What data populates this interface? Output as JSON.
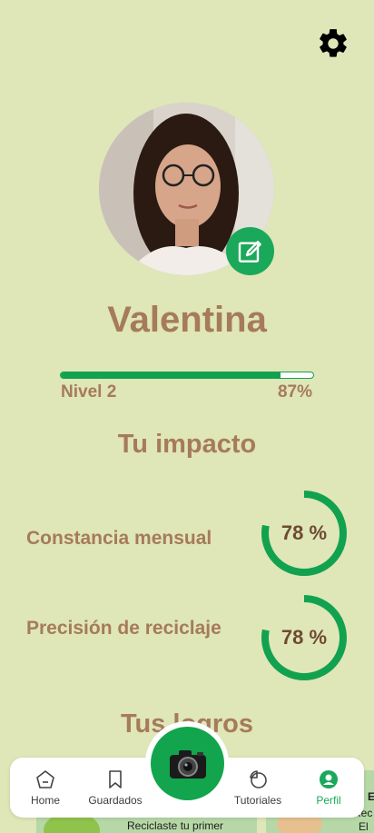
{
  "profile": {
    "name": "Valentina",
    "level_label": "Nivel 2",
    "level_percent_text": "87%",
    "level_progress": 0.87
  },
  "impact": {
    "title": "Tu impacto",
    "metrics": [
      {
        "label": "Constancia mensual",
        "value_text": "78 %",
        "progress": 0.78
      },
      {
        "label": "Precisión de reciclaje",
        "value_text": "78 %",
        "progress": 0.78
      }
    ]
  },
  "logros": {
    "title": "Tus logros",
    "cards": [
      {
        "text": "Reciclaste tu primer"
      },
      {
        "text_a": "Rec",
        "text_b": "El",
        "text_c": "E"
      }
    ]
  },
  "nav": {
    "items": [
      {
        "label": "Home",
        "icon": "home-icon"
      },
      {
        "label": "Guardados",
        "icon": "bookmark-icon"
      },
      {
        "label": "Tutoriales",
        "icon": "tutorials-icon"
      },
      {
        "label": "Perfil",
        "icon": "profile-icon"
      }
    ],
    "center_icon": "camera-icon"
  },
  "colors": {
    "background": "#dfe6b8",
    "accent_green": "#12a24f",
    "text_brown": "#a57b5b"
  }
}
